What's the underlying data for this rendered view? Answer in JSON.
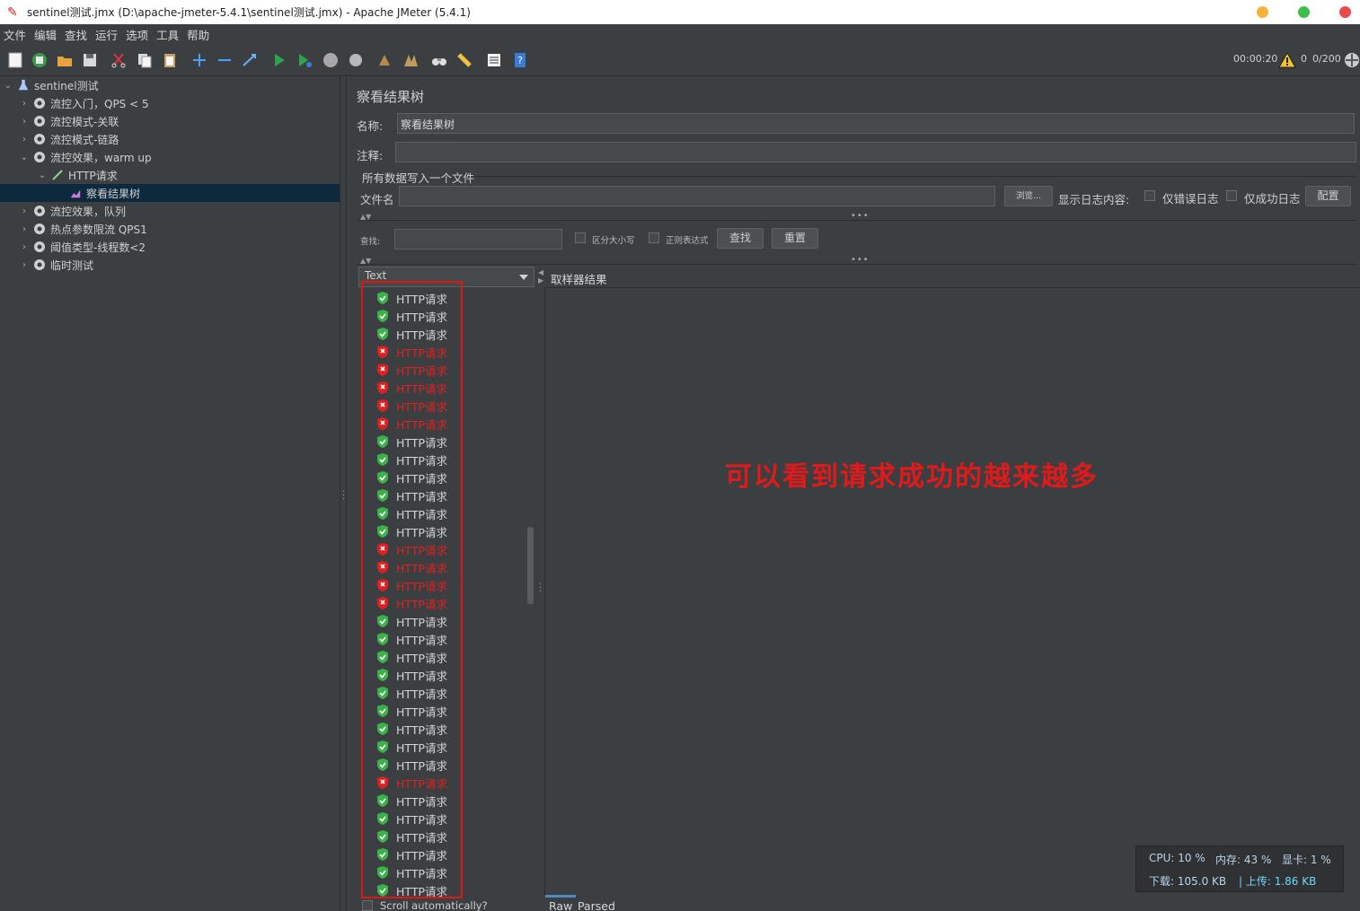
{
  "window": {
    "title": "sentinel测试.jmx (D:\\apache-jmeter-5.4.1\\sentinel测试.jmx) - Apache JMeter (5.4.1)",
    "buttons": {
      "minimize_color": "#f2b43a",
      "maximize_color": "#3cbf4a",
      "close_color": "#ea4b4b"
    }
  },
  "menu": [
    "文件",
    "编辑",
    "查找",
    "运行",
    "选项",
    "工具",
    "帮助"
  ],
  "toolbar": {
    "elapsed_time": "00:00:20",
    "warning_count": "0",
    "threads": "0/200"
  },
  "tree": {
    "root": "sentinel测试",
    "items": [
      {
        "label": "流控入门，QPS < 5",
        "expanded": false
      },
      {
        "label": "流控模式-关联",
        "expanded": false
      },
      {
        "label": "流控模式-链路",
        "expanded": false
      },
      {
        "label": "流控效果，warm up",
        "expanded": true
      },
      {
        "label": "HTTP请求",
        "expanded": true,
        "child": true
      },
      {
        "label": "察看结果树",
        "selected": true,
        "grandchild": true
      },
      {
        "label": "流控效果，队列",
        "expanded": false
      },
      {
        "label": "热点参数限流 QPS1",
        "expanded": false
      },
      {
        "label": "阈值类型-线程数<2",
        "expanded": false
      },
      {
        "label": "临时测试",
        "expanded": false
      }
    ]
  },
  "panel": {
    "title": "察看结果树",
    "name_label": "名称:",
    "name_value": "察看结果树",
    "comment_label": "注释:",
    "comment_value": "",
    "file_group_title": "所有数据写入一个文件",
    "filename_label": "文件名",
    "filename_value": "",
    "browse_button": "浏览...",
    "log_content_label": "显示日志内容:",
    "errors_only_label": "仅错误日志",
    "success_only_label": "仅成功日志",
    "config_button": "配置",
    "search_label": "查找:",
    "search_value": "",
    "case_sensitive_label": "区分大小写",
    "regex_label": "正则表达式",
    "find_button": "查找",
    "reset_button": "重置"
  },
  "results": {
    "renderer": "Text",
    "item_label": "HTTP请求",
    "statuses": [
      "ok",
      "ok",
      "ok",
      "err",
      "err",
      "err",
      "err",
      "err",
      "ok",
      "ok",
      "ok",
      "ok",
      "ok",
      "ok",
      "err",
      "err",
      "err",
      "err",
      "ok",
      "ok",
      "ok",
      "ok",
      "ok",
      "ok",
      "ok",
      "ok",
      "ok",
      "err",
      "ok",
      "ok",
      "ok",
      "ok",
      "ok",
      "ok"
    ],
    "scroll_auto_label": "Scroll automatically?",
    "tab_sampler_result": "取样器结果",
    "tab_raw": "Raw",
    "tab_parsed": "Parsed"
  },
  "annotation": "可以看到请求成功的越来越多",
  "system_monitor": {
    "cpu": "CPU: 10 %",
    "memory": "内存: 43 %",
    "gpu": "显卡: 1 %",
    "download": "下载: 105.0 KB",
    "upload": "上传: 1.86 KB"
  },
  "colors": {
    "ok": "#3cb14a",
    "error": "#e02020",
    "accent": "#4a88c7"
  }
}
